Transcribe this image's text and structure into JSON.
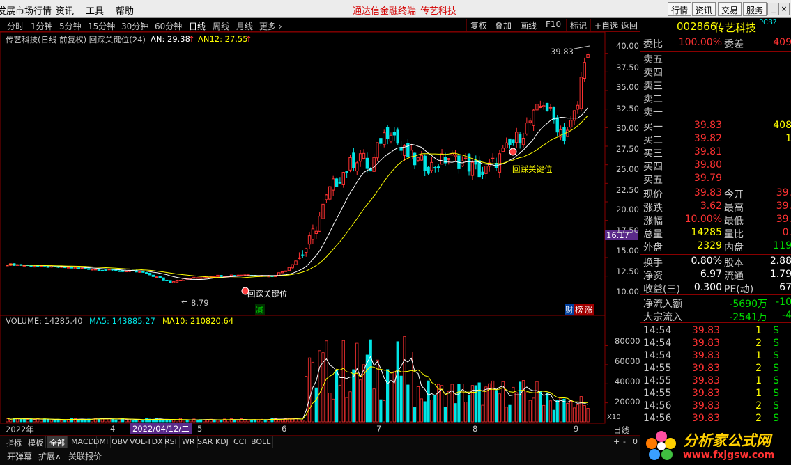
{
  "menubar": {
    "items": [
      "发展市场行情",
      "资讯",
      "工具",
      "帮助"
    ],
    "center": [
      "通达信金融终端",
      "传艺科技"
    ],
    "right_buttons": [
      "行情",
      "资讯",
      "交易",
      "服务"
    ],
    "window_buttons": [
      "_",
      "□",
      "×"
    ]
  },
  "periods": [
    "分时",
    "1分钟",
    "5分钟",
    "15分钟",
    "30分钟",
    "60分钟",
    "日线",
    "周线",
    "月线",
    "更多 ›"
  ],
  "active_period": "日线",
  "tools": [
    "复权",
    "叠加",
    "画线",
    "F10",
    "标记",
    "+自选",
    "返回"
  ],
  "info_line": {
    "name": "传艺科技(日线 前复权) 回踩关键位(24)",
    "an": "AN: 29.38",
    "an12": "AN12: 27.55"
  },
  "price_axis": [
    "40.00",
    "37.50",
    "35.00",
    "32.50",
    "30.00",
    "27.50",
    "25.00",
    "22.50",
    "20.00",
    "17.50",
    "15.00",
    "12.50",
    "10.00"
  ],
  "last_price_tag": "16.17",
  "annotations": {
    "high": "39.83",
    "low": "8.79",
    "key1": "回踩关键位",
    "key2": "回踩关键位",
    "jian": "减",
    "cai": "财",
    "bang": "榜",
    "zhang": "涨"
  },
  "volume_legend": {
    "volume": "VOLUME: 14285.40",
    "ma5": "MA5: 143885.27",
    "ma10": "MA10: 210820.64"
  },
  "volume_axis": [
    "80000",
    "60000",
    "40000",
    "20000"
  ],
  "time_axis": {
    "y2022": "2022年",
    "m4": "4",
    "date": "2022/04/12/二",
    "m5": "5",
    "m6": "6",
    "m7": "7",
    "m8": "8",
    "m9": "9"
  },
  "x10": "X10",
  "chart_data": {
    "type": "candlestick",
    "title": "传艺科技(日线 前复权)",
    "ylim": [
      8,
      41
    ],
    "close_points": [
      [
        0,
        11.6
      ],
      [
        10,
        11.3
      ],
      [
        20,
        11.1
      ],
      [
        30,
        10.8
      ],
      [
        40,
        10.5
      ],
      [
        48,
        9.2
      ],
      [
        50,
        9.5
      ],
      [
        56,
        9.8
      ],
      [
        60,
        10.0
      ],
      [
        70,
        10.2
      ],
      [
        78,
        10.0
      ],
      [
        82,
        10.8
      ],
      [
        86,
        12.5
      ],
      [
        89,
        14.5
      ],
      [
        92,
        18.0
      ],
      [
        95,
        21.5
      ],
      [
        98,
        23.5
      ],
      [
        100,
        24.5
      ],
      [
        104,
        26.5
      ],
      [
        107,
        24.0
      ],
      [
        110,
        28.5
      ],
      [
        113,
        30.0
      ],
      [
        116,
        27.0
      ],
      [
        120,
        25.5
      ],
      [
        125,
        24.8
      ],
      [
        130,
        26.0
      ],
      [
        135,
        25.2
      ],
      [
        140,
        23.8
      ],
      [
        144,
        25.5
      ],
      [
        148,
        27.5
      ],
      [
        152,
        29.5
      ],
      [
        155,
        31.5
      ],
      [
        158,
        33.5
      ],
      [
        161,
        31.0
      ],
      [
        164,
        29.0
      ],
      [
        166,
        30.5
      ],
      [
        168,
        33.0
      ],
      [
        170,
        39.83
      ]
    ],
    "ma_an": 29.38,
    "ma_an12": 27.55,
    "volume_ylim": [
      0,
      95000
    ],
    "last_volume": 14285.4
  },
  "quote": {
    "code": "002866",
    "name": "传艺科技",
    "tag": "PCB?",
    "weibi_label": "委比",
    "weibi": "100.00%",
    "weicha_label": "委差",
    "weicha": "409",
    "sells": [
      {
        "l": "卖五",
        "p": ""
      },
      {
        "l": "卖四",
        "p": ""
      },
      {
        "l": "卖三",
        "p": ""
      },
      {
        "l": "卖二",
        "p": ""
      },
      {
        "l": "卖一",
        "p": ""
      }
    ],
    "buys": [
      {
        "l": "买一",
        "p": "39.83",
        "v": "408"
      },
      {
        "l": "买二",
        "p": "39.82",
        "v": "1"
      },
      {
        "l": "买三",
        "p": "39.81",
        "v": ""
      },
      {
        "l": "买四",
        "p": "39.80",
        "v": ""
      },
      {
        "l": "买五",
        "p": "39.79",
        "v": ""
      }
    ],
    "stats": [
      {
        "l": "现价",
        "v": "39.83",
        "l2": "今开",
        "v2": "39."
      },
      {
        "l": "涨跌",
        "v": "3.62",
        "l2": "最高",
        "v2": "39."
      },
      {
        "l": "涨幅",
        "v": "10.00%",
        "l2": "最低",
        "v2": "39."
      },
      {
        "l": "总量",
        "v": "14285",
        "l2": "量比",
        "v2": "0."
      },
      {
        "l": "外盘",
        "v": "2329",
        "l2": "内盘",
        "v2": "119"
      }
    ],
    "stats2": [
      {
        "l": "换手",
        "v": "0.80%",
        "l2": "股本",
        "v2": "2.88"
      },
      {
        "l": "净资",
        "v": "6.97",
        "l2": "流通",
        "v2": "1.79"
      },
      {
        "l": "收益(三)",
        "v": "0.300",
        "l2": "PE(动)",
        "v2": "67"
      }
    ],
    "flows": [
      {
        "l": "净流入额",
        "v": "-5690万",
        "v2": "-10"
      },
      {
        "l": "大宗流入",
        "v": "-2541万",
        "v2": "-4"
      }
    ],
    "ticks": [
      {
        "t": "14:54",
        "p": "39.83",
        "v": "1",
        "s": "S"
      },
      {
        "t": "14:54",
        "p": "39.83",
        "v": "2",
        "s": "S"
      },
      {
        "t": "14:54",
        "p": "39.83",
        "v": "1",
        "s": "S"
      },
      {
        "t": "14:55",
        "p": "39.83",
        "v": "2",
        "s": "S"
      },
      {
        "t": "14:55",
        "p": "39.83",
        "v": "1",
        "s": "S"
      },
      {
        "t": "14:55",
        "p": "39.83",
        "v": "1",
        "s": "S"
      },
      {
        "t": "14:56",
        "p": "39.83",
        "v": "2",
        "s": "S"
      },
      {
        "t": "14:56",
        "p": "39.83",
        "v": "2",
        "s": "S"
      }
    ]
  },
  "bottom_tabs": [
    "指标",
    "模板",
    "全部",
    "MACD",
    "DMI",
    "OBV",
    "VOL-TDX",
    "RSI",
    "WR",
    "SAR",
    "KDJ",
    "CCI",
    "BOLL"
  ],
  "bottom_right": [
    "日线",
    "+",
    "-",
    "0"
  ],
  "bottom_bar": [
    "开弹幕",
    "扩展∧",
    "关联报价"
  ],
  "logo": {
    "title": "分析家公式网",
    "url": "www.fxjgsw.com"
  },
  "colors": {
    "up": "#ff3232",
    "down": "#00e5e5",
    "ma1": "#ffffff",
    "ma2": "#ffff00",
    "axis": "#8a0000"
  }
}
